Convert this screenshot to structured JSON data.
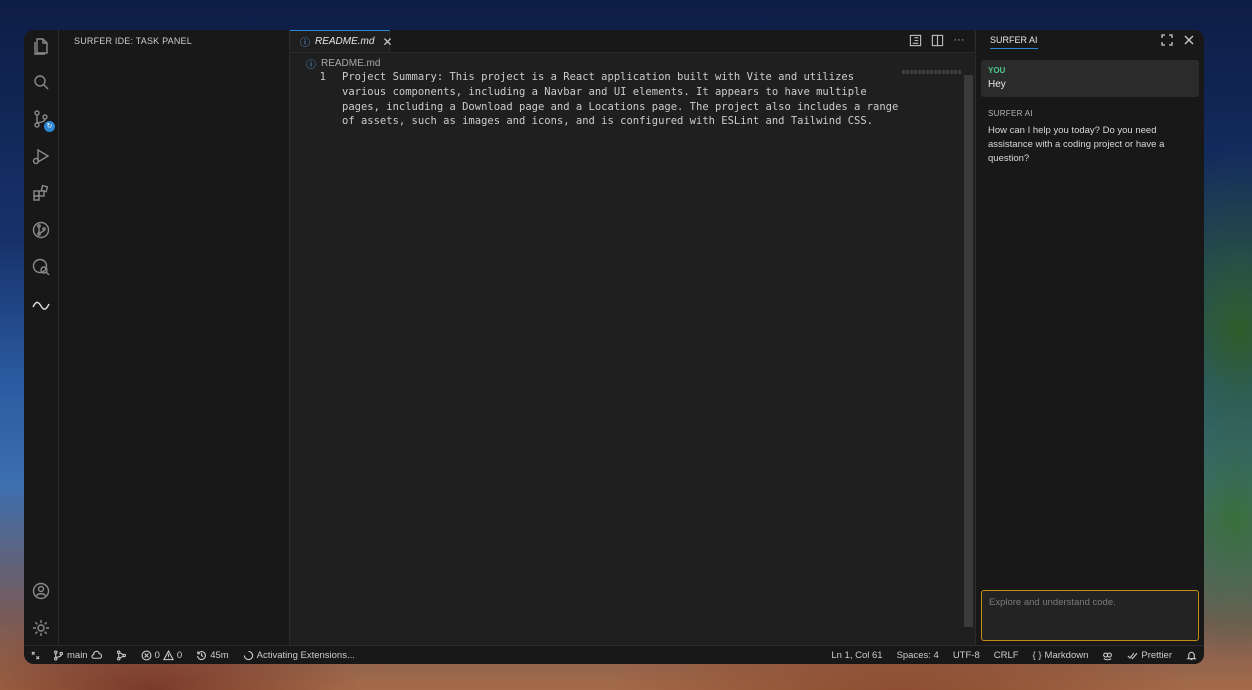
{
  "sidebar": {
    "title": "SURFER IDE: TASK PANEL"
  },
  "editor": {
    "tab": {
      "label": "README.md"
    },
    "breadcrumb": "README.md",
    "lines": [
      {
        "number": "1",
        "text": "Project Summary: This project is a React application built with Vite and utilizes various components, including a Navbar and UI elements. It appears to have multiple pages, including a Download page and a Locations page. The project also includes a range of assets, such as images and icons, and is configured with ESLint and Tailwind CSS."
      }
    ]
  },
  "chat": {
    "title": "SURFER AI",
    "messages": [
      {
        "who": "YOU",
        "text": "Hey"
      },
      {
        "who": "SURFER AI",
        "text": "How can I help you today? Do you need assistance with a coding project or have a question?"
      }
    ],
    "input_placeholder": "Explore and understand code."
  },
  "statusbar": {
    "branch": "main",
    "errors": "0",
    "warnings": "0",
    "time": "45m",
    "activity": "Activating Extensions...",
    "position": "Ln 1, Col 61",
    "spaces": "Spaces: 4",
    "encoding": "UTF-8",
    "eol": "CRLF",
    "language": "Markdown",
    "formatter": "Prettier"
  },
  "colors": {
    "accent": "#2f86d3",
    "user_label": "#4ec98a",
    "input_border": "#c28e15"
  }
}
